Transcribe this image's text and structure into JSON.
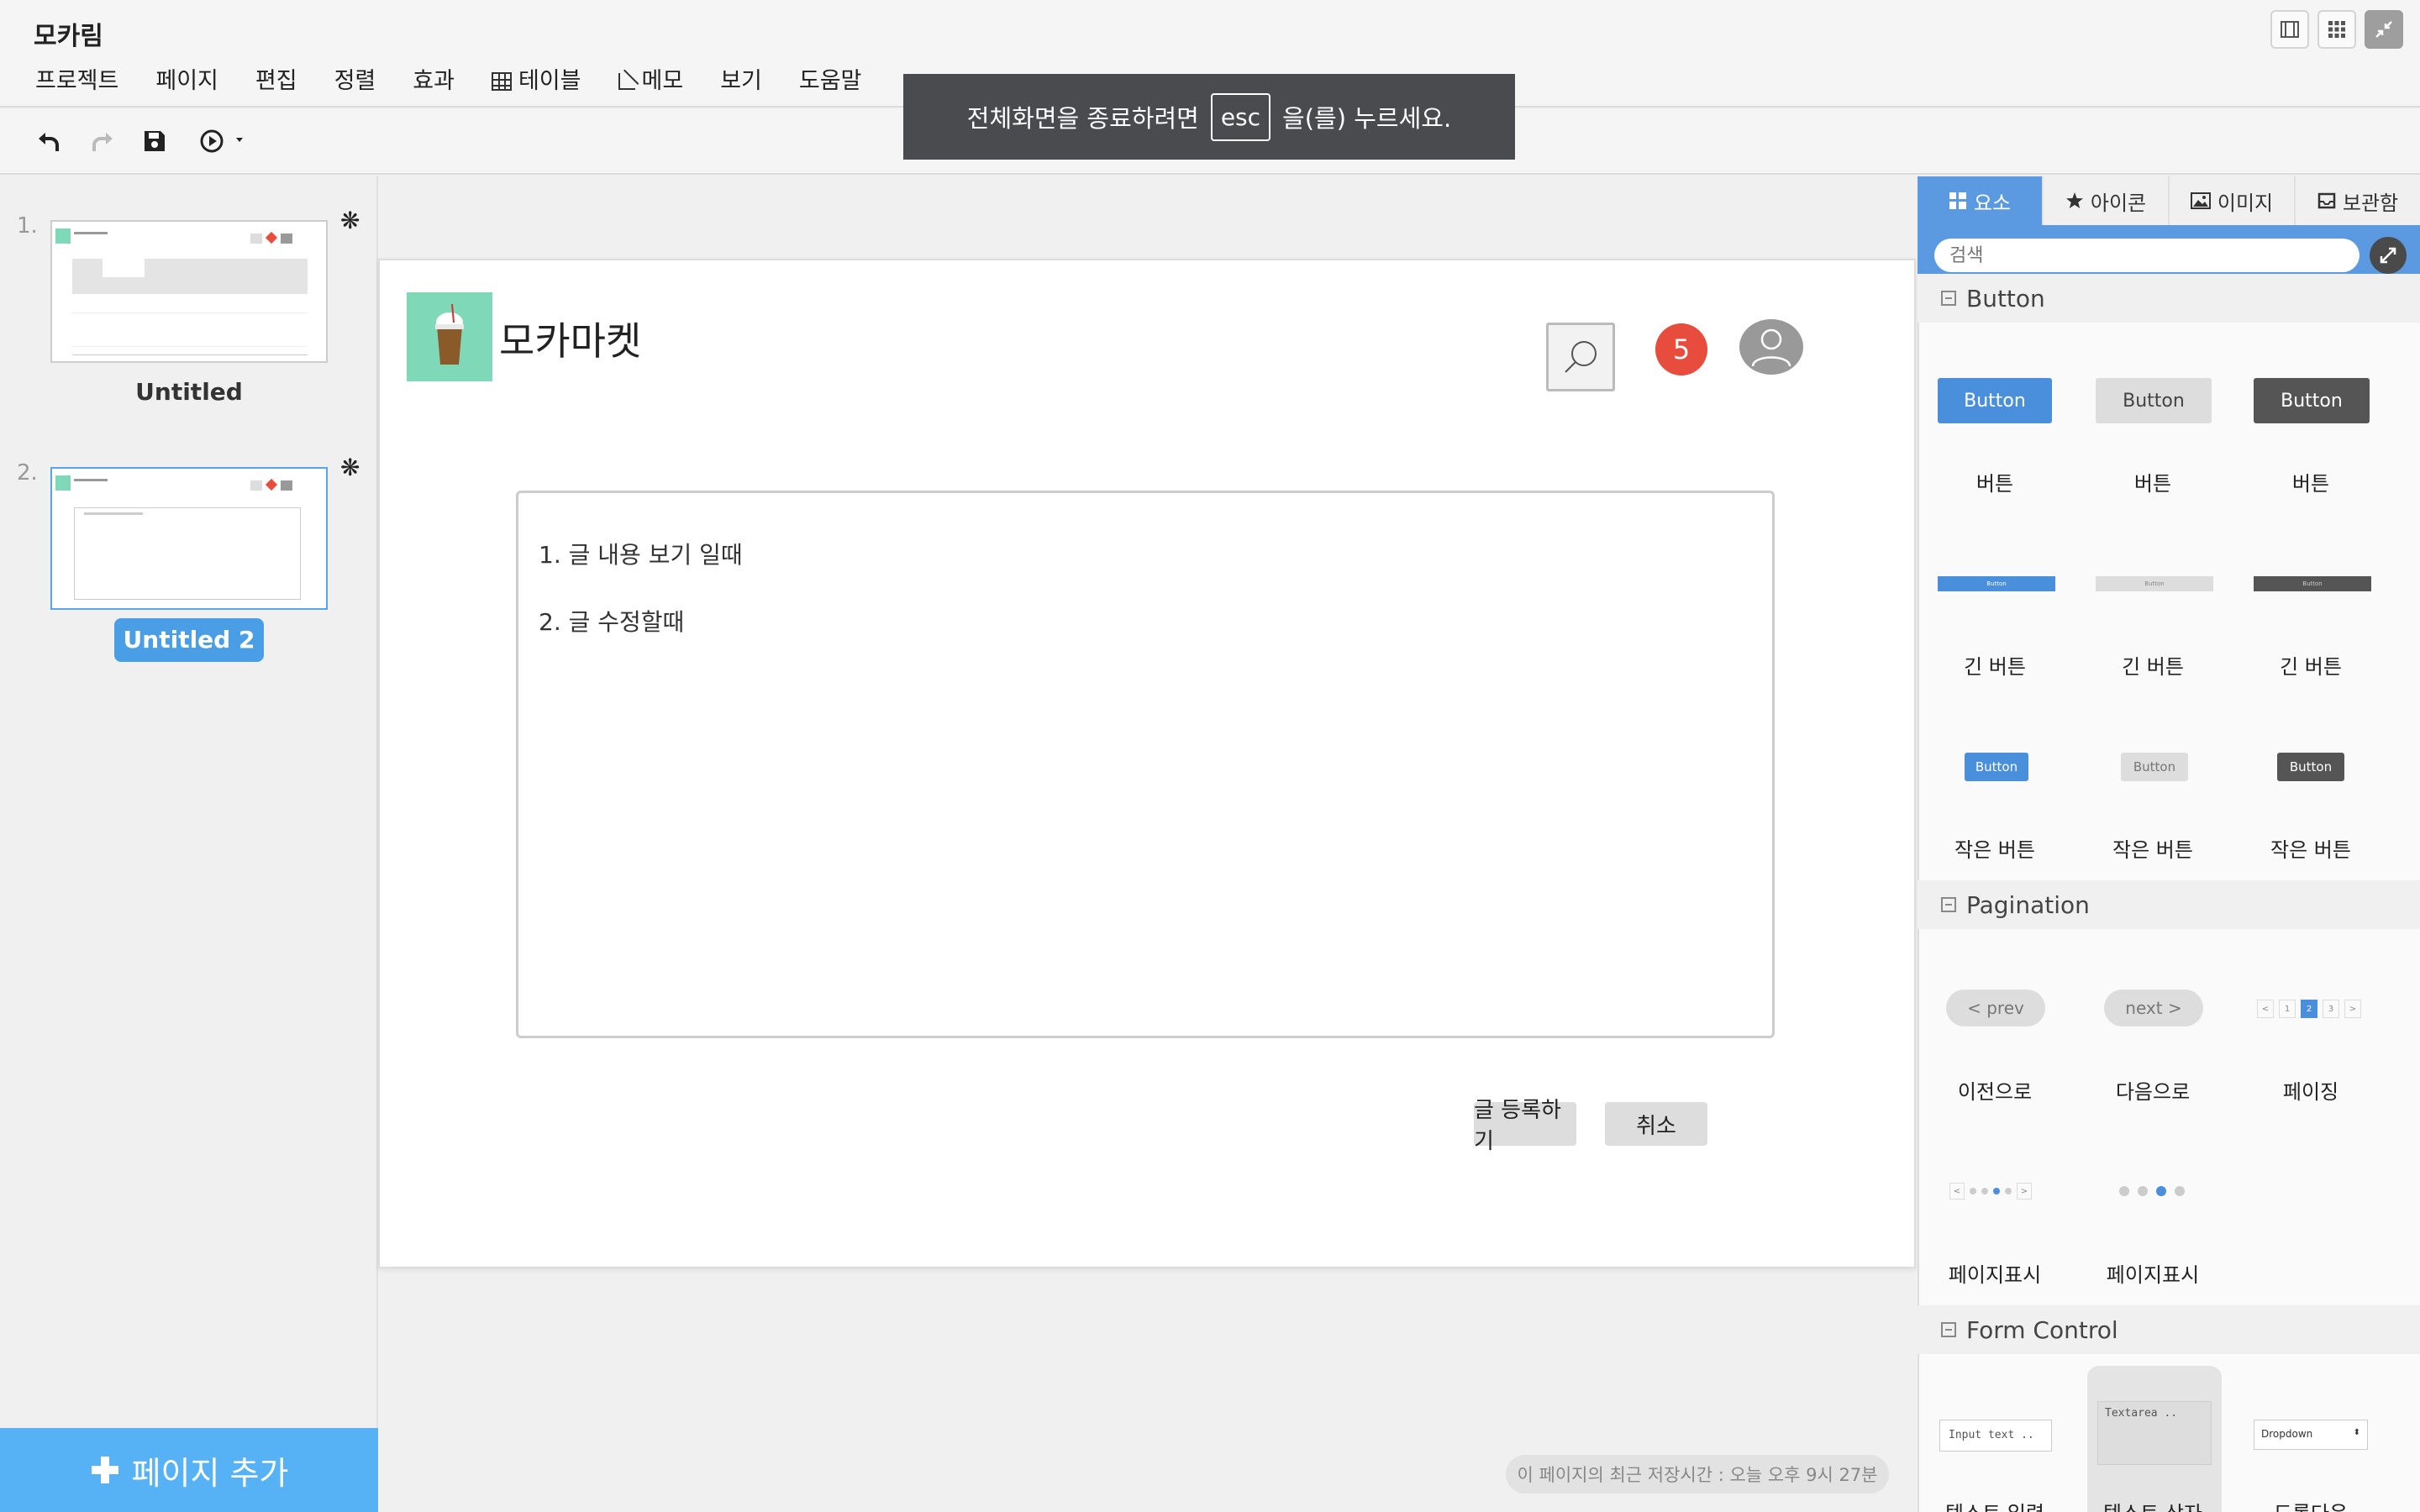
{
  "app": {
    "title": "모카림"
  },
  "menu": [
    "프로젝트",
    "페이지",
    "편집",
    "정렬",
    "효과",
    "테이블",
    "메모",
    "보기",
    "도움말"
  ],
  "toast": {
    "prefix": "전체화면을 종료하려면",
    "key": "esc",
    "suffix": "을(를) 누르세요."
  },
  "pages": [
    {
      "number": "1.",
      "name": "Untitled",
      "star": "❋"
    },
    {
      "number": "2.",
      "name": "Untitled 2",
      "star": "❋"
    }
  ],
  "add_page": "페이지 추가",
  "canvas": {
    "market_title": "모카마켓",
    "notification_count": "5",
    "content_lines": [
      "1. 글 내용 보기 일때",
      "2. 글 수정할때"
    ],
    "submit_label": "글 등록하기",
    "cancel_label": "취소"
  },
  "save_status": "이 페이지의 최근 저장시간 : 오늘 오후 9시 27분",
  "right_panel": {
    "tabs": [
      "요소",
      "아이콘",
      "이미지",
      "보관함"
    ],
    "search_placeholder": "검색",
    "sections": {
      "button": {
        "title": "Button",
        "sample_text": "Button",
        "labels": [
          "버튼",
          "버튼",
          "버튼",
          "긴 버튼",
          "긴 버튼",
          "긴 버튼",
          "작은 버튼",
          "작은 버튼",
          "작은 버튼"
        ]
      },
      "pagination": {
        "title": "Pagination",
        "prev_text": "< prev",
        "next_text": "next >",
        "pager": [
          "<",
          "1",
          "2",
          "3",
          ">"
        ],
        "dots_pager": [
          "<",
          ">"
        ],
        "labels": [
          "이전으로",
          "다음으로",
          "페이징",
          "페이지표시",
          "페이지표시"
        ]
      },
      "form_control": {
        "title": "Form Control",
        "input_sample": "Input text ..",
        "textarea_sample": "Textarea ..",
        "dropdown_sample": "Dropdown",
        "labels": [
          "텍스트 입력",
          "텍스트 상자",
          "드롭다운"
        ]
      }
    }
  },
  "colors": {
    "accent": "#5b9ae0",
    "add_page": "#56b2f5",
    "badge": "#e84c3d",
    "toast": "#4a4b4e"
  }
}
